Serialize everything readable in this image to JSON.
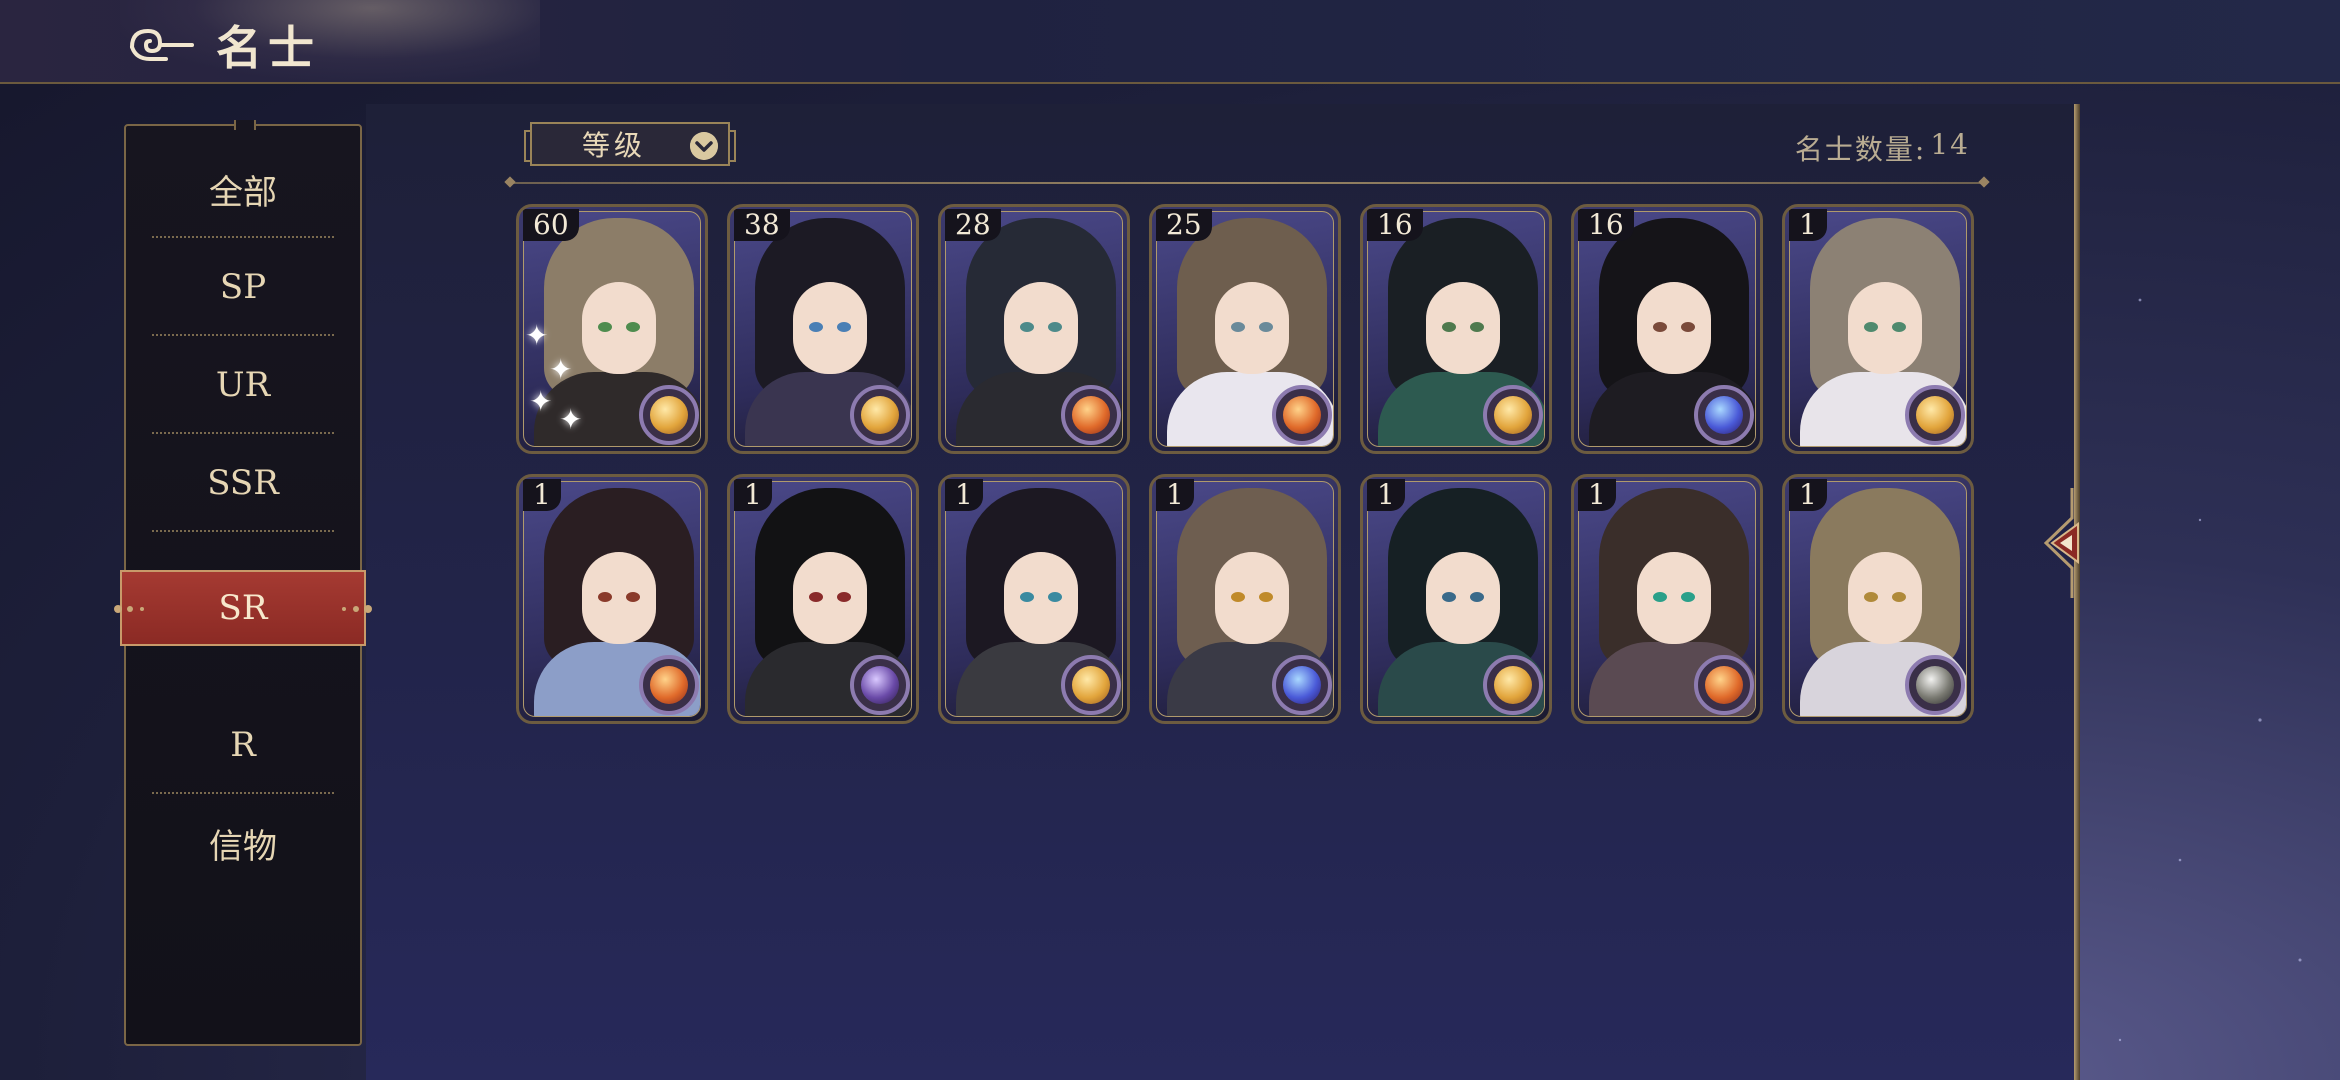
{
  "header": {
    "title": "名士"
  },
  "sidebar": {
    "items": [
      {
        "label": "全部"
      },
      {
        "label": "SP"
      },
      {
        "label": "UR"
      },
      {
        "label": "SSR"
      },
      {
        "label": "SR"
      },
      {
        "label": "R"
      },
      {
        "label": "信物"
      }
    ],
    "active": "SR"
  },
  "toolbar": {
    "sort_label": "等级",
    "count_label": "名士数量:",
    "count_value": "14"
  },
  "cards": [
    {
      "level": "60",
      "hair": "#8c7d68",
      "eyes": "#4f8c4e",
      "outfit": "#2f2a2a",
      "element": "gold",
      "sparkle": true
    },
    {
      "level": "38",
      "hair": "#1c1a24",
      "eyes": "#4a7fb5",
      "outfit": "#3a3550",
      "element": "gold",
      "sparkle": false
    },
    {
      "level": "28",
      "hair": "#262a36",
      "eyes": "#4d8a8a",
      "outfit": "#2a2a30",
      "element": "fire",
      "sparkle": false
    },
    {
      "level": "25",
      "hair": "#6e5e4e",
      "eyes": "#6a8a9a",
      "outfit": "#e9e6ee",
      "element": "fire",
      "sparkle": false
    },
    {
      "level": "16",
      "hair": "#1a1f24",
      "eyes": "#4f7a4e",
      "outfit": "#2d5a50",
      "element": "gold",
      "sparkle": false
    },
    {
      "level": "16",
      "hair": "#151418",
      "eyes": "#7a4a3a",
      "outfit": "#1e1c22",
      "element": "cosmic",
      "sparkle": false
    },
    {
      "level": "1",
      "hair": "#8c8174",
      "eyes": "#4f8a6e",
      "outfit": "#e8e4ea",
      "element": "gold",
      "sparkle": false
    },
    {
      "level": "1",
      "hair": "#2a1e22",
      "eyes": "#8a3a2a",
      "outfit": "#8c9ec8",
      "element": "fire",
      "sparkle": false
    },
    {
      "level": "1",
      "hair": "#121214",
      "eyes": "#8a2a2a",
      "outfit": "#2a2a2e",
      "element": "violet",
      "sparkle": false
    },
    {
      "level": "1",
      "hair": "#1c1822",
      "eyes": "#3a8aa0",
      "outfit": "#3a3a40",
      "element": "gold",
      "sparkle": false
    },
    {
      "level": "1",
      "hair": "#6e5e50",
      "eyes": "#c08a2a",
      "outfit": "#3a3a46",
      "element": "cosmic",
      "sparkle": false
    },
    {
      "level": "1",
      "hair": "#162024",
      "eyes": "#3a6a8a",
      "outfit": "#2a4a4a",
      "element": "gold",
      "sparkle": false
    },
    {
      "level": "1",
      "hair": "#3a2e2a",
      "eyes": "#2aa08a",
      "outfit": "#5a4a52",
      "element": "fire",
      "sparkle": false
    },
    {
      "level": "1",
      "hair": "#8a7a5e",
      "eyes": "#b08a3a",
      "outfit": "#d8d4dc",
      "element": "silver",
      "sparkle": false
    }
  ],
  "colors": {
    "accent_gold": "#b59b70",
    "active_red": "#9b322b",
    "text_cream": "#e6d6b4"
  },
  "icons": {
    "title": "cloud-swirl-icon",
    "sort": "chevron-down-icon",
    "right_tab": "arrow-left-icon"
  }
}
